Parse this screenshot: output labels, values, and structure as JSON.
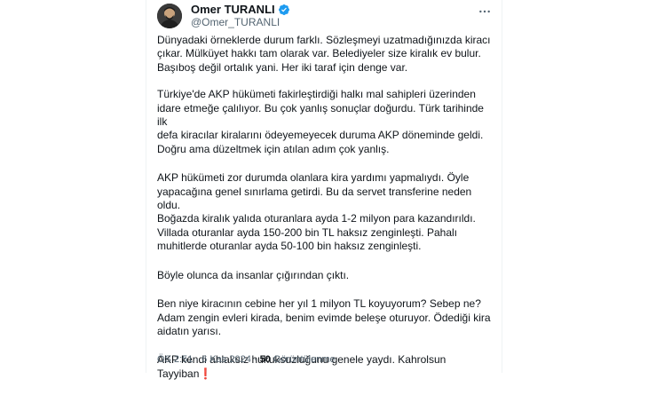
{
  "author": {
    "display_name": "Omer TURANLI",
    "handle": "@Omer_TURANLI"
  },
  "tweet": {
    "paragraphs": [
      "Dünyadaki örneklerde durum farklı. Sözleşmeyi uzatmadığınızda kiracı\nçıkar. Mülküyet hakkı tam olarak var. Belediyeler size kiralık ev bulur.\nBaşıboş değil ortalık yani. Her iki taraf için denge var.",
      "Türkiye'de  AKP hükümeti fakirleştirdiği halkı mal sahipleri üzerinden\nidare etmeğe çalılıyor. Bu çok yanlış sonuçlar doğurdu. Türk tarihinde ilk\ndefa kiracılar kiralarını ödeyemeyecek duruma AKP döneminde geldi.\nDoğru ama düzeltmek için atılan adım çok yanlış.",
      "AKP hükümeti zor durumda olanlara kira yardımı yapmalıydı. Öyle\nyapacağına genel sınırlama getirdi. Bu da servet transferine neden oldu.\nBoğazda kiralık yalıda oturanlara ayda 1-2 milyon para kazandırıldı.\nVillada oturanlar ayda 150-200 bin TL haksız zenginleşti. Pahalı\nmuhitlerde oturanlar ayda 50-100 bin haksız zenginleşti.",
      "Böyle olunca da insanlar çığırından çıktı.",
      "Ben niye kiracının cebine her yıl 1 milyon TL koyuyorum? Sebep ne?\nAdam zengin evleri kirada, benim evimde beleşe oturuyor. Ödediği kira\naidatın yarısı."
    ],
    "last_paragraph": "AKP kendi ahlaksız hukuksuzluğunu genele yaydı. Kahrolsun Tayyiban",
    "last_paragraph_emoji": "❗"
  },
  "meta": {
    "time": "ÖS 2:51",
    "separator": "·",
    "date": "6 Kas 2024",
    "views_count": "50",
    "views_label": "Görüntülenme"
  },
  "icons": {
    "verified": "verified-badge-icon",
    "more": "more-horizontal-icon"
  },
  "colors": {
    "verified": "#1d9bf0",
    "text": "#0f1419",
    "secondary": "#536471",
    "emoji": "#e0245e"
  }
}
